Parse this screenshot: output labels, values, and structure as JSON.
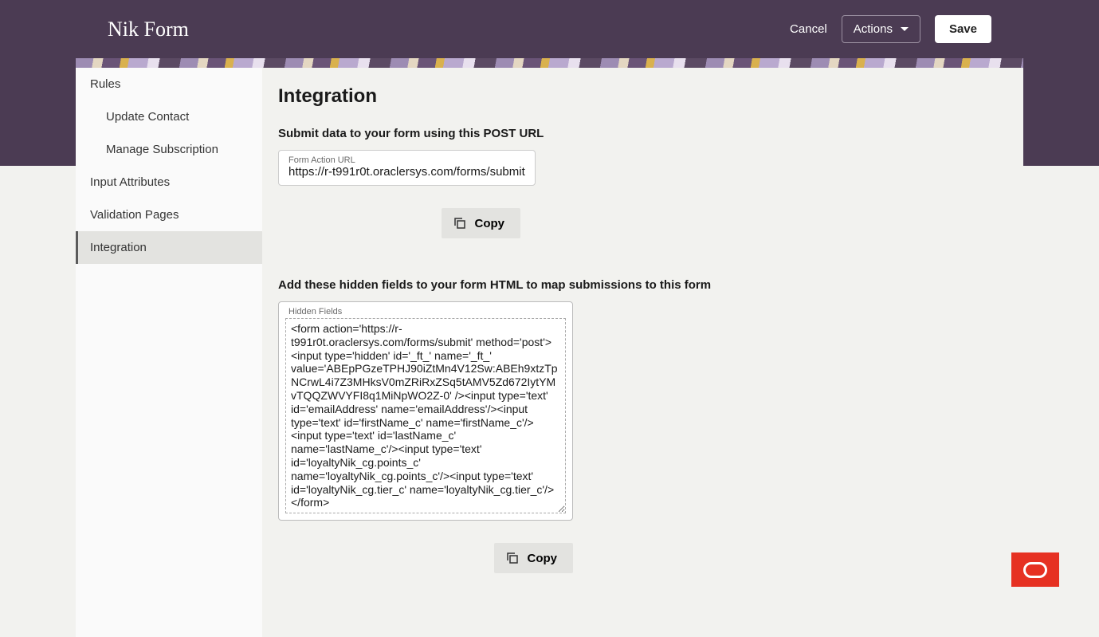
{
  "header": {
    "title": "Nik Form",
    "cancel_label": "Cancel",
    "actions_label": "Actions",
    "save_label": "Save"
  },
  "sidebar": {
    "items": [
      {
        "label": "Rules",
        "sub": false,
        "active": false
      },
      {
        "label": "Update Contact",
        "sub": true,
        "active": false
      },
      {
        "label": "Manage Subscription",
        "sub": true,
        "active": false
      },
      {
        "label": "Input Attributes",
        "sub": false,
        "active": false
      },
      {
        "label": "Validation Pages",
        "sub": false,
        "active": false
      },
      {
        "label": "Integration",
        "sub": false,
        "active": true
      }
    ]
  },
  "main": {
    "title": "Integration",
    "url_section": {
      "heading": "Submit data to your form using this POST URL",
      "field_label": "Form Action URL",
      "field_value": "https://r-t991r0t.oraclersys.com/forms/submit",
      "copy_label": "Copy"
    },
    "hidden_section": {
      "heading": "Add these hidden fields to your form HTML to map submissions to this form",
      "field_label": "Hidden Fields",
      "field_value": "<form action='https://r-t991r0t.oraclersys.com/forms/submit' method='post'>\n<input type='hidden' id='_ft_' name='_ft_' value='ABEpPGzeTPHJ90iZtMn4V12Sw:ABEh9xtzTpNCrwL4i7Z3MHksV0mZRiRxZSq5tAMV5Zd672IytYMvTQQZWVYFI8q1MiNpWO2Z-0' /><input type='text' id='emailAddress' name='emailAddress'/><input type='text' id='firstName_c' name='firstName_c'/><input type='text' id='lastName_c' name='lastName_c'/><input type='text' id='loyaltyNik_cg.points_c' name='loyaltyNik_cg.points_c'/><input type='text' id='loyaltyNik_cg.tier_c' name='loyaltyNik_cg.tier_c'/>\n</form>",
      "copy_label": "Copy"
    }
  }
}
